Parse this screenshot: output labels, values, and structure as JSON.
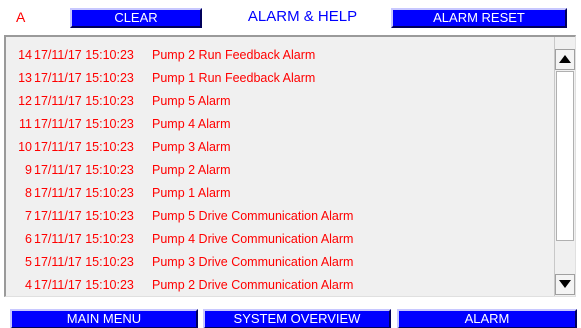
{
  "header": {
    "indicator": "A",
    "clear_label": "CLEAR",
    "title": "ALARM & HELP",
    "reset_label": "ALARM RESET"
  },
  "alarms": [
    {
      "num": "14",
      "timestamp": "17/11/17 15:10:23",
      "message": "Pump 2 Run Feedback Alarm"
    },
    {
      "num": "13",
      "timestamp": "17/11/17 15:10:23",
      "message": "Pump 1 Run Feedback Alarm"
    },
    {
      "num": "12",
      "timestamp": "17/11/17 15:10:23",
      "message": "Pump 5 Alarm"
    },
    {
      "num": "11",
      "timestamp": "17/11/17 15:10:23",
      "message": "Pump 4 Alarm"
    },
    {
      "num": "10",
      "timestamp": "17/11/17 15:10:23",
      "message": "Pump 3 Alarm"
    },
    {
      "num": "9",
      "timestamp": "17/11/17 15:10:23",
      "message": "Pump 2 Alarm"
    },
    {
      "num": "8",
      "timestamp": "17/11/17 15:10:23",
      "message": "Pump 1 Alarm"
    },
    {
      "num": "7",
      "timestamp": "17/11/17 15:10:23",
      "message": "Pump 5 Drive Communication Alarm"
    },
    {
      "num": "6",
      "timestamp": "17/11/17 15:10:23",
      "message": "Pump 4 Drive Communication Alarm"
    },
    {
      "num": "5",
      "timestamp": "17/11/17 15:10:23",
      "message": "Pump 3 Drive Communication Alarm"
    },
    {
      "num": "4",
      "timestamp": "17/11/17 15:10:23",
      "message": "Pump 2 Drive Communication Alarm"
    }
  ],
  "scrollbar": {
    "up_icon": "arrow-up-icon",
    "down_icon": "arrow-down-icon"
  },
  "nav": {
    "main_menu": "MAIN MENU",
    "system_overview": "SYSTEM OVERVIEW",
    "alarm": "ALARM"
  },
  "colors": {
    "alarm_text": "#ff0000",
    "button_bg": "#0000ff",
    "button_text": "#ffffff",
    "title_text": "#0000ff"
  }
}
